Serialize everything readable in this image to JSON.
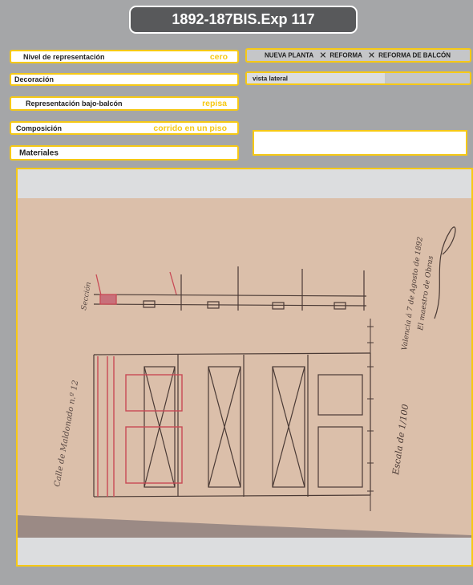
{
  "header": {
    "title": "1892-187BIS.Exp 117"
  },
  "fields": {
    "nivel": {
      "label": "Nivel de representación",
      "value": "cero"
    },
    "decoracion": {
      "label": "Decoración",
      "value": ""
    },
    "bajo_balcon": {
      "label": "Representación bajo-balcón",
      "value": "repisa"
    },
    "composicion": {
      "label": "Composición",
      "value": "corrido en un piso"
    },
    "materiales": {
      "label": "Materiales",
      "value": ""
    }
  },
  "tags": {
    "items": [
      "NUEVA PLANTA",
      "REFORMA",
      "REFORMA DE  BALCÓN"
    ],
    "separator": "✕"
  },
  "vista": {
    "value": "vista lateral"
  },
  "drawing": {
    "handwriting": {
      "left_caption": "Calle de Maldonado n.º 12",
      "section_caption": "Sección",
      "right_line1": "Valencia á 7 de Agosto de 1892",
      "right_line2": "El maestro de Obras",
      "scale": "Escala de 1/100"
    }
  },
  "colors": {
    "accent": "#f6c915",
    "title_bg": "#58595b",
    "page_bg": "#a5a6a8"
  }
}
